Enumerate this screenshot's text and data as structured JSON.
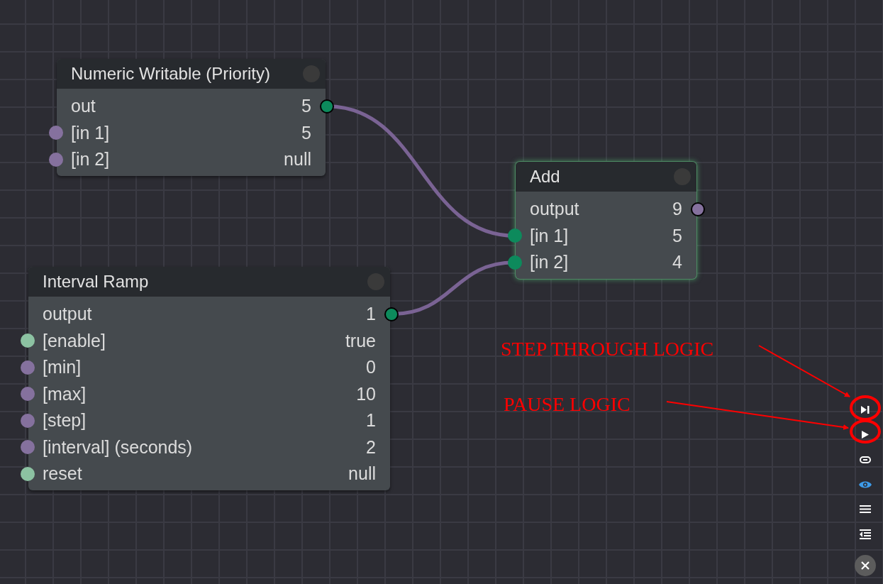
{
  "nodes": [
    {
      "title": "Numeric Writable (Priority)",
      "selected": false,
      "rows": [
        {
          "kind": "output",
          "label": "out",
          "value": "5",
          "color": "#0d8a5c"
        },
        {
          "kind": "input",
          "label": "[in 1]",
          "value": "5",
          "color": "#85719e"
        },
        {
          "kind": "input",
          "label": "[in 2]",
          "value": "null",
          "color": "#85719e"
        }
      ]
    },
    {
      "title": "Add",
      "selected": true,
      "rows": [
        {
          "kind": "output",
          "label": "output",
          "value": "9",
          "color": "#85719e"
        },
        {
          "kind": "input",
          "label": "[in 1]",
          "value": "5",
          "color": "#0d8a5c"
        },
        {
          "kind": "input",
          "label": "[in 2]",
          "value": "4",
          "color": "#0d8a5c"
        }
      ]
    },
    {
      "title": "Interval Ramp",
      "selected": false,
      "rows": [
        {
          "kind": "output",
          "label": "output",
          "value": "1",
          "color": "#0d8a5c"
        },
        {
          "kind": "input",
          "label": "[enable]",
          "value": "true",
          "color": "#8cc2a2"
        },
        {
          "kind": "input",
          "label": "[min]",
          "value": "0",
          "color": "#85719e"
        },
        {
          "kind": "input",
          "label": "[max]",
          "value": "10",
          "color": "#85719e"
        },
        {
          "kind": "input",
          "label": "[step]",
          "value": "1",
          "color": "#85719e"
        },
        {
          "kind": "input",
          "label": "[interval] (seconds)",
          "value": "2",
          "color": "#85719e"
        },
        {
          "kind": "input",
          "label": "reset",
          "value": "null",
          "color": "#8cc2a2"
        }
      ]
    }
  ],
  "toolbar": [
    {
      "kind": "step",
      "active": false
    },
    {
      "kind": "play",
      "active": false
    },
    {
      "kind": "link",
      "active": false
    },
    {
      "kind": "eye",
      "active": true
    },
    {
      "kind": "menu",
      "active": false
    },
    {
      "kind": "indent",
      "active": false
    },
    {
      "kind": "close",
      "active": false
    }
  ],
  "annotations": [
    {
      "text": "STEP THROUGH LOGIC"
    },
    {
      "text": "PAUSE LOGIC"
    }
  ]
}
